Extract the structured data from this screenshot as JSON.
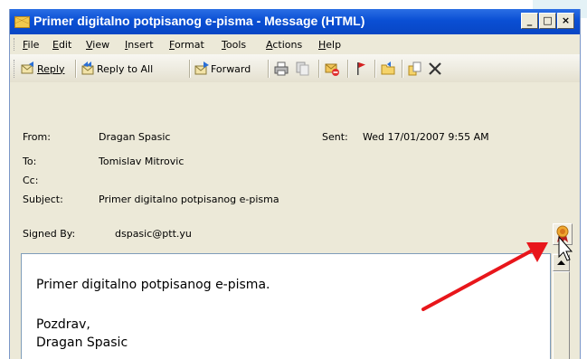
{
  "window": {
    "title": "Primer digitalno potpisanog e-pisma - Message (HTML)",
    "controls": {
      "minimize": "_",
      "maximize": "□",
      "close": "×"
    }
  },
  "menu": [
    "File",
    "Edit",
    "View",
    "Insert",
    "Format",
    "Tools",
    "Actions",
    "Help"
  ],
  "toolbar": {
    "reply": "Reply",
    "reply_all": "Reply to All",
    "forward": "Forward"
  },
  "headers": {
    "from_label": "From:",
    "from_value": "Dragan Spasic",
    "sent_label": "Sent:",
    "sent_value": "Wed 17/01/2007 9:55 AM",
    "to_label": "To:",
    "to_value": "Tomislav Mitrovic",
    "cc_label": "Cc:",
    "subject_label": "Subject:",
    "subject_value": "Primer digitalno potpisanog e-pisma",
    "signed_label": "Signed By:",
    "signed_value": "dspasic@ptt.yu"
  },
  "body": {
    "line1": "Primer digitalno potpisanog e-pisma.",
    "line2": "Pozdrav,",
    "line3": "Dragan Spasic"
  },
  "colors": {
    "title_bar": "#0a4fd4",
    "chrome": "#ece9d8",
    "arrow": "#e8161b"
  },
  "icons": [
    "envelope-icon",
    "reply-icon",
    "reply-all-icon",
    "forward-icon",
    "print-icon",
    "copy-icon",
    "delete-message-icon",
    "flag-icon",
    "folder-icon",
    "move-icon",
    "delete-icon",
    "certificate-icon",
    "mouse-cursor-icon",
    "red-arrow"
  ]
}
